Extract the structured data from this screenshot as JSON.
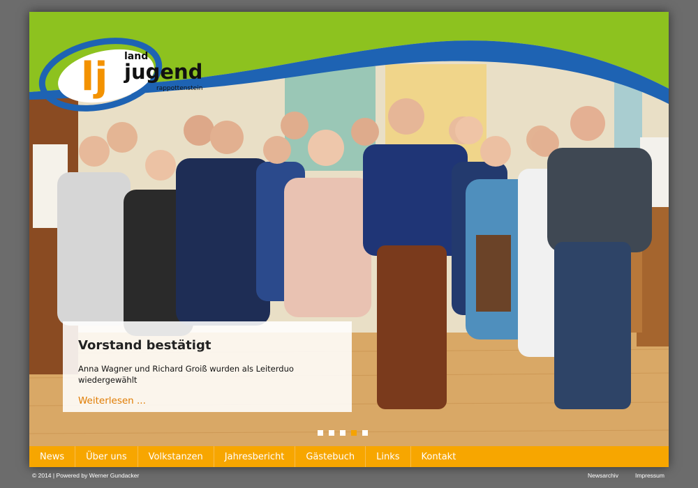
{
  "logo": {
    "letters": "lj",
    "word_top": "land",
    "word_main": "jugend",
    "word_sub": "rappottenstein"
  },
  "slide": {
    "title": "Vorstand bestätigt",
    "text": "Anna Wagner und Richard Groiß wurden als Leiterduo wiedergewählt",
    "link": "Weiterlesen ..."
  },
  "carousel": {
    "count": 5,
    "active_index": 3
  },
  "nav": {
    "items": [
      {
        "label": "News"
      },
      {
        "label": "Über uns"
      },
      {
        "label": "Volkstanzen"
      },
      {
        "label": "Jahresbericht"
      },
      {
        "label": "Gästebuch"
      },
      {
        "label": "Links"
      },
      {
        "label": "Kontakt"
      }
    ]
  },
  "footer": {
    "copyright": "© 2014 | Powered by Werner Gundacker",
    "links": [
      {
        "label": "Newsarchiv"
      },
      {
        "label": "Impressum"
      }
    ]
  },
  "colors": {
    "header_green": "#8dc21f",
    "header_blue": "#1e63b3",
    "nav_orange": "#f7a600",
    "accent_orange": "#e07b00",
    "frame_gray": "#6c6c6c"
  }
}
